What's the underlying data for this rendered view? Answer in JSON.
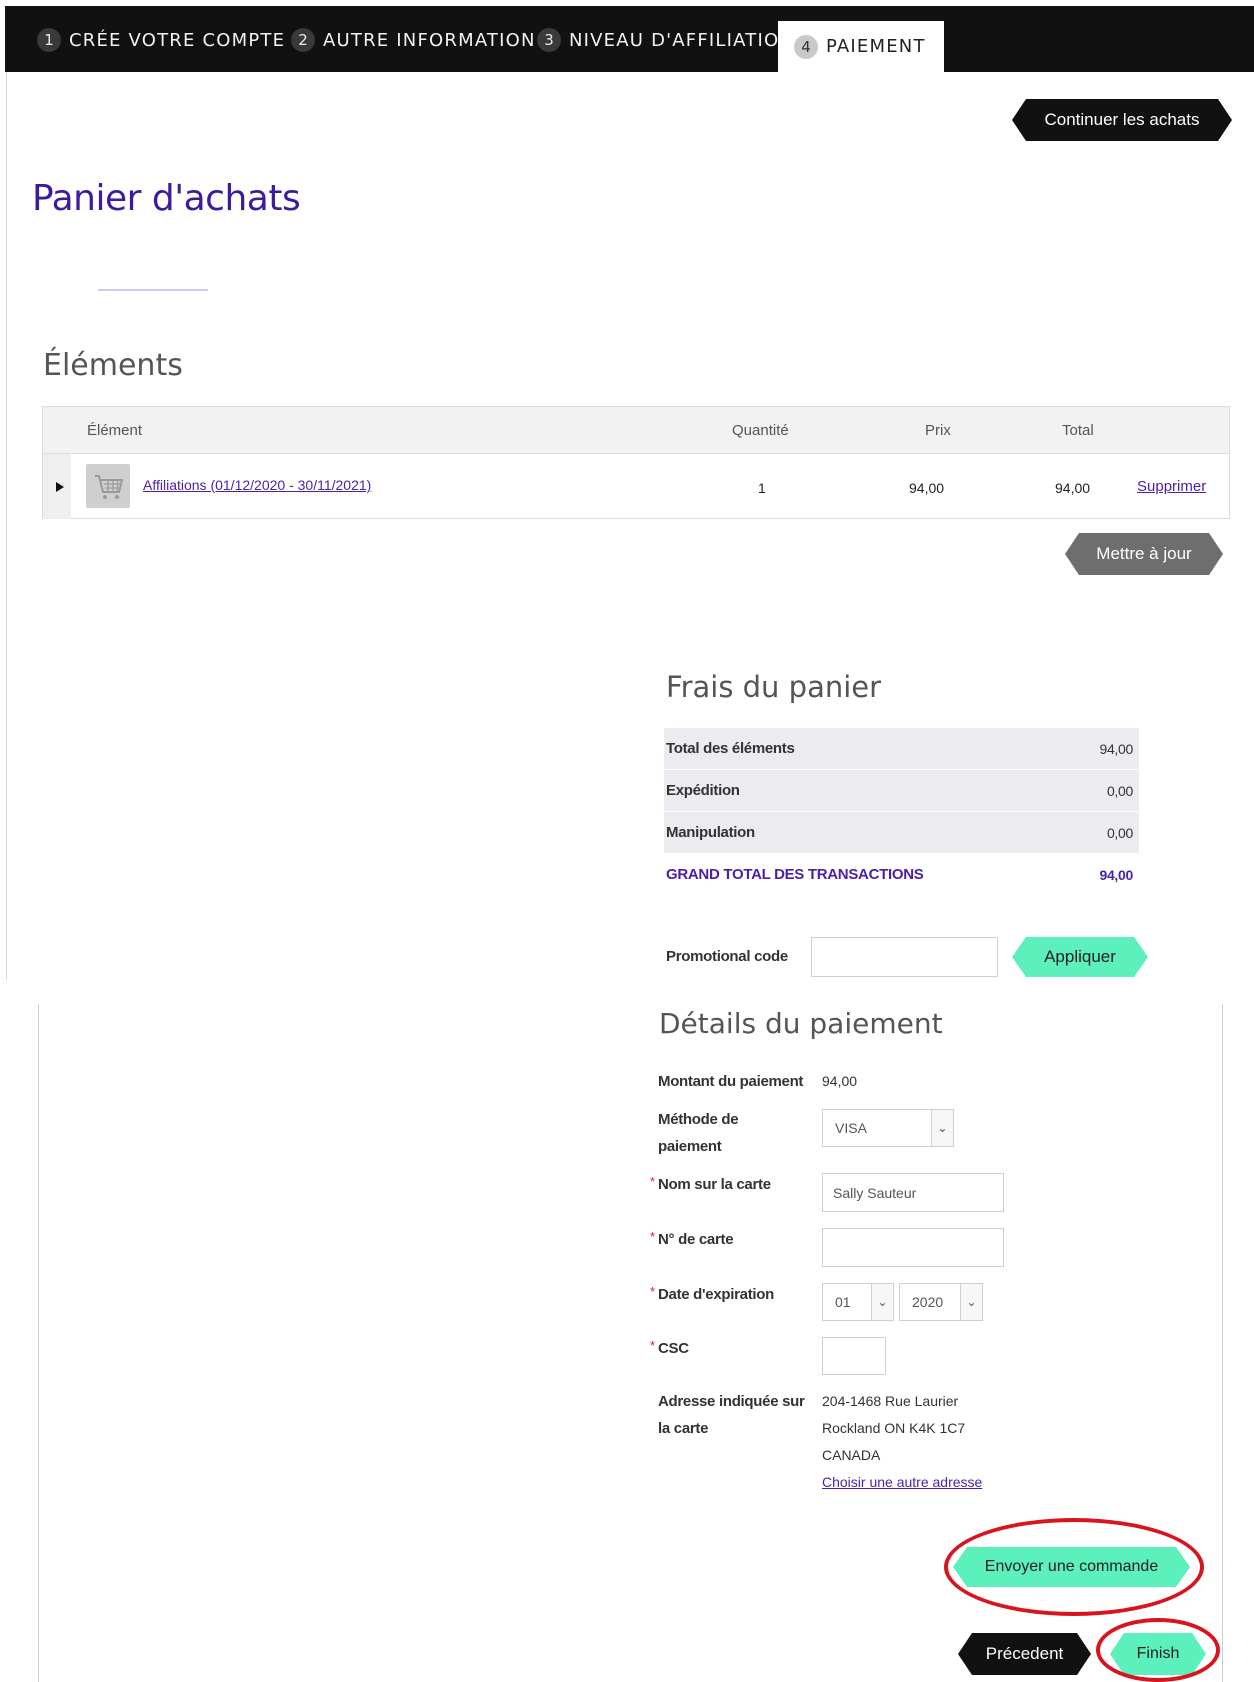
{
  "steps": [
    {
      "num": "1",
      "label": "CRÉE VOTRE COMPTE"
    },
    {
      "num": "2",
      "label": "AUTRE INFORMATION"
    },
    {
      "num": "3",
      "label": "NIVEAU D'AFFILIATION"
    },
    {
      "num": "4",
      "label": "PAIEMENT"
    }
  ],
  "continue_label": "Continuer les achats",
  "page_title": "Panier d'achats",
  "items": {
    "title": "Éléments",
    "headers": {
      "item": "Élément",
      "quantity": "Quantité",
      "price": "Prix",
      "total": "Total"
    },
    "rows": [
      {
        "name": "Affiliations (01/12/2020 - 30/11/2021)",
        "quantity": "1",
        "price": "94,00",
        "total": "94,00",
        "remove": "Supprimer"
      }
    ],
    "update_label": "Mettre à jour"
  },
  "fees": {
    "title": "Frais du panier",
    "rows": [
      {
        "label": "Total des éléments",
        "value": "94,00"
      },
      {
        "label": "Expédition",
        "value": "0,00"
      },
      {
        "label": "Manipulation",
        "value": "0,00"
      }
    ],
    "grand_label": "GRAND TOTAL DES TRANSACTIONS",
    "grand_value": "94,00"
  },
  "promo": {
    "label": "Promotional code",
    "value": "",
    "apply_label": "Appliquer"
  },
  "payment": {
    "title": "Détails du paiement",
    "amount_label": "Montant du paiement",
    "amount_value": "94,00",
    "method_label_1": "Méthode de",
    "method_label_2": "paiement",
    "method_value": "VISA",
    "name_label": "Nom sur la carte",
    "name_value": "Sally Sauteur",
    "card_label": "N° de carte",
    "card_value": "",
    "expiry_label": "Date d'expiration",
    "expiry_month": "01",
    "expiry_year": "2020",
    "csc_label": "CSC",
    "csc_value": "",
    "address_label_1": "Adresse indiquée sur",
    "address_label_2": "la carte",
    "address_lines": [
      "204-1468 Rue Laurier",
      "Rockland ON K4K 1C7",
      "CANADA"
    ],
    "address_link": "Choisir une autre adresse",
    "required_mark": "*"
  },
  "actions": {
    "submit_label": "Envoyer une commande",
    "previous_label": "Précedent",
    "finish_label": "Finish"
  },
  "colors": {
    "accent": "#3e1a9e",
    "mint": "#5cf0bd",
    "annotation": "#d8141f"
  }
}
